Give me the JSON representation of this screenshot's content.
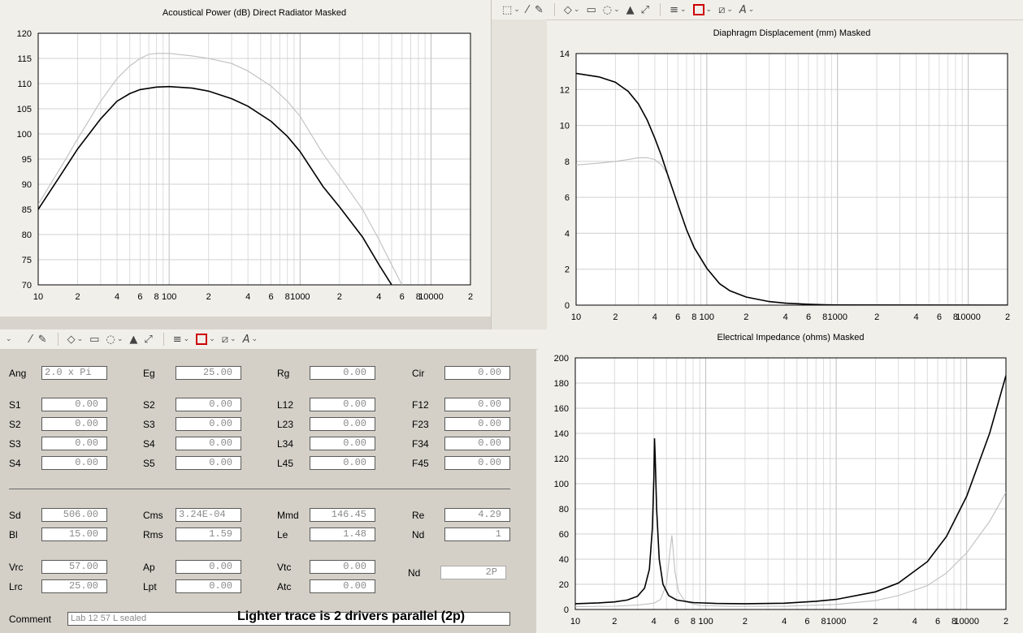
{
  "toolbar_icons": [
    "select-rect-icon",
    "magic-wand-icon",
    "brush-icon",
    "shape-icon",
    "text-box-icon",
    "lasso-icon",
    "fill-icon",
    "resize-icon",
    "line-style-icon",
    "outline-color-icon",
    "fill-color-icon",
    "font-icon"
  ],
  "form": {
    "rows": [
      {
        "cells": [
          {
            "label": "Ang",
            "value": "2.0 x Pi",
            "align": "left"
          },
          {
            "label": "Eg",
            "value": "25.00"
          },
          {
            "label": "Rg",
            "value": "0.00"
          },
          {
            "label": "Cir",
            "value": "0.00"
          }
        ]
      },
      {
        "cells": [
          {
            "label": "S1",
            "value": "0.00"
          },
          {
            "label": "S2",
            "value": "0.00"
          },
          {
            "label": "L12",
            "value": "0.00"
          },
          {
            "label": "F12",
            "value": "0.00"
          }
        ]
      },
      {
        "cells": [
          {
            "label": "S2",
            "value": "0.00"
          },
          {
            "label": "S3",
            "value": "0.00"
          },
          {
            "label": "L23",
            "value": "0.00"
          },
          {
            "label": "F23",
            "value": "0.00"
          }
        ]
      },
      {
        "cells": [
          {
            "label": "S3",
            "value": "0.00"
          },
          {
            "label": "S4",
            "value": "0.00"
          },
          {
            "label": "L34",
            "value": "0.00"
          },
          {
            "label": "F34",
            "value": "0.00"
          }
        ]
      },
      {
        "cells": [
          {
            "label": "S4",
            "value": "0.00"
          },
          {
            "label": "S5",
            "value": "0.00"
          },
          {
            "label": "L45",
            "value": "0.00"
          },
          {
            "label": "F45",
            "value": "0.00"
          }
        ]
      },
      {
        "cells": [
          {
            "label": "Sd",
            "value": "506.00"
          },
          {
            "label": "Cms",
            "value": "3.24E-04",
            "align": "left"
          },
          {
            "label": "Mmd",
            "value": "146.45"
          },
          {
            "label": "Re",
            "value": "4.29"
          }
        ]
      },
      {
        "cells": [
          {
            "label": "Bl",
            "value": "15.00"
          },
          {
            "label": "Rms",
            "value": "1.59"
          },
          {
            "label": "Le",
            "value": "1.48"
          },
          {
            "label": "Nd",
            "value": "1"
          }
        ]
      },
      {
        "cells": [
          {
            "label": "Vrc",
            "value": "57.00"
          },
          {
            "label": "Ap",
            "value": "0.00"
          },
          {
            "label": "Vtc",
            "value": "0.00"
          },
          {
            "label": "Nd",
            "value": "2P"
          }
        ]
      },
      {
        "cells": [
          {
            "label": "Lrc",
            "value": "25.00"
          },
          {
            "label": "Lpt",
            "value": "0.00"
          },
          {
            "label": "Atc",
            "value": "0.00"
          }
        ]
      }
    ],
    "comment_label": "Comment",
    "comment_value": "Lab 12 57 L sealed",
    "note": "Lighter trace is 2 drivers parallel (2p)"
  },
  "chart_data": [
    {
      "id": "power",
      "type": "line",
      "title": "Acoustical Power (dB)   Direct Radiator   Masked",
      "x_scale": "log",
      "xlim": [
        10,
        20000
      ],
      "ylim": [
        70,
        120
      ],
      "yticks": [
        70,
        75,
        80,
        85,
        90,
        95,
        100,
        105,
        110,
        115,
        120
      ],
      "xtick_labels": [
        [
          10,
          "10"
        ],
        [
          20,
          "2"
        ],
        [
          40,
          "4"
        ],
        [
          60,
          "6"
        ],
        [
          80,
          "8"
        ],
        [
          100,
          "100"
        ],
        [
          200,
          "2"
        ],
        [
          400,
          "4"
        ],
        [
          600,
          "6"
        ],
        [
          800,
          "8"
        ],
        [
          1000,
          "1000"
        ],
        [
          2000,
          "2"
        ],
        [
          4000,
          "4"
        ],
        [
          6000,
          "6"
        ],
        [
          8000,
          "8"
        ],
        [
          10000,
          "10000"
        ],
        [
          20000,
          "2"
        ]
      ],
      "grid": true,
      "series": [
        {
          "color": "#000000",
          "points": [
            [
              10,
              85
            ],
            [
              15,
              92
            ],
            [
              20,
              97
            ],
            [
              30,
              103
            ],
            [
              40,
              106.5
            ],
            [
              50,
              108
            ],
            [
              60,
              108.8
            ],
            [
              80,
              109.3
            ],
            [
              100,
              109.4
            ],
            [
              150,
              109.1
            ],
            [
              200,
              108.5
            ],
            [
              300,
              107
            ],
            [
              400,
              105.5
            ],
            [
              600,
              102.5
            ],
            [
              800,
              99.5
            ],
            [
              1000,
              96.5
            ],
            [
              1500,
              89.5
            ],
            [
              2000,
              85.5
            ],
            [
              3000,
              79.5
            ],
            [
              4000,
              74
            ],
            [
              5000,
              70
            ]
          ]
        },
        {
          "color": "#bfbfbf",
          "points": [
            [
              10,
              86
            ],
            [
              15,
              93.5
            ],
            [
              20,
              99
            ],
            [
              30,
              106.5
            ],
            [
              40,
              111
            ],
            [
              50,
              113.5
            ],
            [
              60,
              115
            ],
            [
              70,
              115.8
            ],
            [
              80,
              116
            ],
            [
              100,
              116
            ],
            [
              150,
              115.5
            ],
            [
              200,
              115
            ],
            [
              300,
              114
            ],
            [
              400,
              112.5
            ],
            [
              600,
              109.5
            ],
            [
              800,
              106.5
            ],
            [
              1000,
              103.5
            ],
            [
              1500,
              96
            ],
            [
              2000,
              91.5
            ],
            [
              3000,
              85
            ],
            [
              4000,
              79
            ],
            [
              5000,
              74
            ],
            [
              6000,
              70
            ]
          ]
        }
      ]
    },
    {
      "id": "displacement",
      "type": "line",
      "title": "Diaphragm Displacement (mm)   Masked",
      "x_scale": "log",
      "xlim": [
        10,
        20000
      ],
      "ylim": [
        0,
        14
      ],
      "yticks": [
        0,
        2,
        4,
        6,
        8,
        10,
        12,
        14
      ],
      "xtick_labels": [
        [
          10,
          "10"
        ],
        [
          20,
          "2"
        ],
        [
          40,
          "4"
        ],
        [
          60,
          "6"
        ],
        [
          80,
          "8"
        ],
        [
          100,
          "100"
        ],
        [
          200,
          "2"
        ],
        [
          400,
          "4"
        ],
        [
          600,
          "6"
        ],
        [
          800,
          "8"
        ],
        [
          1000,
          "1000"
        ],
        [
          2000,
          "2"
        ],
        [
          4000,
          "4"
        ],
        [
          6000,
          "6"
        ],
        [
          8000,
          "8"
        ],
        [
          10000,
          "10000"
        ],
        [
          20000,
          "2"
        ]
      ],
      "grid": true,
      "series": [
        {
          "color": "#000000",
          "points": [
            [
              10,
              12.9
            ],
            [
              15,
              12.7
            ],
            [
              20,
              12.4
            ],
            [
              25,
              11.9
            ],
            [
              30,
              11.2
            ],
            [
              35,
              10.3
            ],
            [
              40,
              9.3
            ],
            [
              45,
              8.3
            ],
            [
              50,
              7.3
            ],
            [
              60,
              5.6
            ],
            [
              70,
              4.2
            ],
            [
              80,
              3.2
            ],
            [
              100,
              2.05
            ],
            [
              125,
              1.2
            ],
            [
              150,
              0.8
            ],
            [
              200,
              0.45
            ],
            [
              300,
              0.2
            ],
            [
              400,
              0.11
            ],
            [
              600,
              0.05
            ],
            [
              800,
              0.02
            ],
            [
              1000,
              0.01
            ],
            [
              20000,
              0
            ]
          ]
        },
        {
          "color": "#bfbfbf",
          "points": [
            [
              10,
              7.8
            ],
            [
              15,
              7.9
            ],
            [
              20,
              8.0
            ],
            [
              25,
              8.1
            ],
            [
              30,
              8.2
            ],
            [
              35,
              8.2
            ],
            [
              40,
              8.1
            ],
            [
              45,
              7.8
            ],
            [
              50,
              7.3
            ],
            [
              60,
              5.6
            ],
            [
              70,
              4.2
            ],
            [
              80,
              3.2
            ],
            [
              100,
              2.05
            ],
            [
              125,
              1.2
            ],
            [
              150,
              0.8
            ],
            [
              200,
              0.45
            ],
            [
              300,
              0.2
            ],
            [
              400,
              0.11
            ],
            [
              600,
              0.05
            ],
            [
              800,
              0.02
            ],
            [
              1000,
              0.01
            ],
            [
              20000,
              0
            ]
          ]
        }
      ]
    },
    {
      "id": "impedance",
      "type": "line",
      "title": "Electrical Impedance (ohms)   Masked",
      "x_scale": "log",
      "xlim": [
        10,
        20000
      ],
      "ylim": [
        0,
        200
      ],
      "yticks": [
        0,
        20,
        40,
        60,
        80,
        100,
        120,
        140,
        160,
        180,
        200
      ],
      "xtick_labels": [
        [
          10,
          "10"
        ],
        [
          20,
          "2"
        ],
        [
          40,
          "4"
        ],
        [
          60,
          "6"
        ],
        [
          80,
          "8"
        ],
        [
          100,
          "100"
        ],
        [
          200,
          "2"
        ],
        [
          400,
          "4"
        ],
        [
          600,
          "6"
        ],
        [
          800,
          "8"
        ],
        [
          1000,
          "1000"
        ],
        [
          2000,
          "2"
        ],
        [
          4000,
          "4"
        ],
        [
          6000,
          "6"
        ],
        [
          8000,
          "8"
        ],
        [
          10000,
          "10000"
        ],
        [
          20000,
          "2"
        ]
      ],
      "grid": true,
      "series": [
        {
          "color": "#000000",
          "points": [
            [
              10,
              4.6
            ],
            [
              15,
              5.2
            ],
            [
              20,
              6
            ],
            [
              25,
              7.5
            ],
            [
              30,
              10.5
            ],
            [
              34,
              17
            ],
            [
              37,
              32
            ],
            [
              39,
              65
            ],
            [
              40,
              105
            ],
            [
              40.5,
              136
            ],
            [
              41,
              120
            ],
            [
              42,
              80
            ],
            [
              44,
              40
            ],
            [
              47,
              20
            ],
            [
              52,
              11
            ],
            [
              60,
              7.5
            ],
            [
              80,
              5.5
            ],
            [
              120,
              4.8
            ],
            [
              200,
              4.6
            ],
            [
              400,
              5.0
            ],
            [
              700,
              6.5
            ],
            [
              1000,
              8
            ],
            [
              2000,
              14
            ],
            [
              3000,
              21
            ],
            [
              5000,
              38
            ],
            [
              7000,
              58
            ],
            [
              10000,
              90
            ],
            [
              15000,
              140
            ],
            [
              20000,
              186
            ]
          ]
        },
        {
          "color": "#bfbfbf",
          "points": [
            [
              10,
              2.3
            ],
            [
              20,
              2.6
            ],
            [
              30,
              3.5
            ],
            [
              40,
              5
            ],
            [
              45,
              8
            ],
            [
              50,
              20
            ],
            [
              53,
              45
            ],
            [
              55,
              59
            ],
            [
              56,
              50
            ],
            [
              58,
              30
            ],
            [
              62,
              14
            ],
            [
              70,
              6
            ],
            [
              90,
              3.2
            ],
            [
              150,
              2.5
            ],
            [
              400,
              2.5
            ],
            [
              1000,
              4
            ],
            [
              2000,
              7
            ],
            [
              3000,
              11
            ],
            [
              5000,
              19
            ],
            [
              7000,
              29
            ],
            [
              10000,
              45
            ],
            [
              15000,
              70
            ],
            [
              20000,
              93
            ]
          ]
        }
      ]
    }
  ]
}
